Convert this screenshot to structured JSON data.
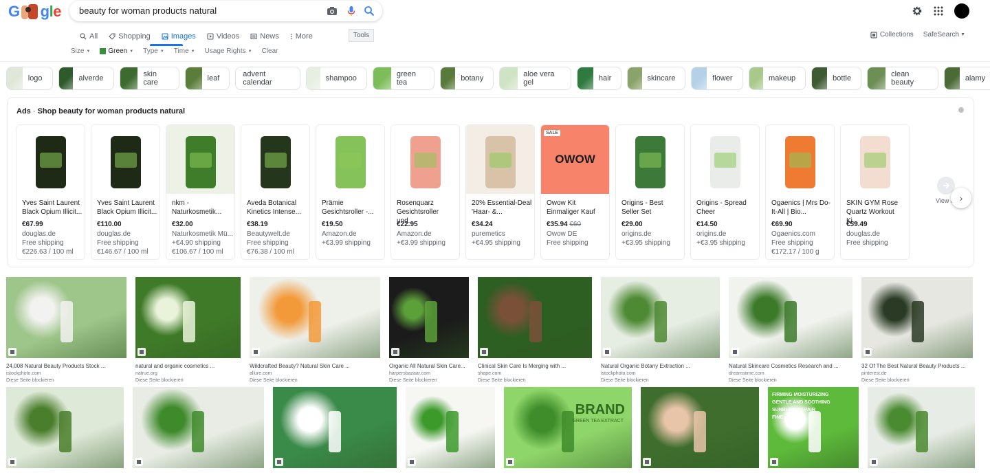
{
  "search": {
    "query": "beauty for woman products natural"
  },
  "logo": {
    "text": "Google"
  },
  "tabs": [
    {
      "label": "All",
      "icon": "search-icon"
    },
    {
      "label": "Shopping",
      "icon": "tag-icon"
    },
    {
      "label": "Images",
      "icon": "image-icon",
      "active": true
    },
    {
      "label": "Videos",
      "icon": "play-icon"
    },
    {
      "label": "News",
      "icon": "newspaper-icon"
    },
    {
      "label": "More",
      "icon": "kebab-icon"
    }
  ],
  "tools_label": "Tools",
  "collections_label": "Collections",
  "safesearch_label": "SafeSearch",
  "filters": [
    {
      "label": "Size"
    },
    {
      "label": "Green",
      "swatch": "#3a8f3a",
      "active": true
    },
    {
      "label": "Type"
    },
    {
      "label": "Time"
    },
    {
      "label": "Usage Rights"
    },
    {
      "label": "Clear"
    }
  ],
  "chips": [
    {
      "label": "logo",
      "color": "#dfe8d8"
    },
    {
      "label": "alverde",
      "color": "#2f5a2c"
    },
    {
      "label": "skin care",
      "color": "#3d6b2f"
    },
    {
      "label": "leaf",
      "color": "#5a7d3b"
    },
    {
      "label": "advent calendar",
      "color": ""
    },
    {
      "label": "shampoo",
      "color": "#e7efe3"
    },
    {
      "label": "green tea",
      "color": "#7cbd5a"
    },
    {
      "label": "botany",
      "color": "#587a3a"
    },
    {
      "label": "aloe vera gel",
      "color": "#cfe4c4"
    },
    {
      "label": "hair",
      "color": "#2f7a3e"
    },
    {
      "label": "skincare",
      "color": "#8aa36a"
    },
    {
      "label": "flower",
      "color": "#b5d1e8"
    },
    {
      "label": "makeup",
      "color": "#a9c98c"
    },
    {
      "label": "bottle",
      "color": "#3e5b34"
    },
    {
      "label": "clean beauty",
      "color": "#6d8f56"
    },
    {
      "label": "alamy",
      "color": "#4b6a36"
    }
  ],
  "ads": {
    "prefix": "Ads",
    "title": "Shop beauty for woman products natural",
    "view_all_label": "View all",
    "items": [
      {
        "title": "Yves Saint Laurent Black Opium Illicit...",
        "price": "€67.99",
        "old_price": "",
        "store": "douglas.de",
        "shipping": "Free shipping",
        "unit": "€226.63 / 100 ml",
        "bg": "#ffffff",
        "product": "#1e2a16",
        "sale": ""
      },
      {
        "title": "Yves Saint Laurent Black Opium Illicit...",
        "price": "€110.00",
        "old_price": "",
        "store": "douglas.de",
        "shipping": "Free shipping",
        "unit": "€146.67 / 100 ml",
        "bg": "#ffffff",
        "product": "#1e2a16",
        "sale": ""
      },
      {
        "title": "nkm - Naturkosmetik...",
        "price": "€32.00",
        "old_price": "",
        "store": "Naturkosmetik Mü...",
        "shipping": "+€4.90 shipping",
        "unit": "€106.67 / 100 ml",
        "bg": "#eef1e6",
        "product": "#3f7d2a",
        "sale": ""
      },
      {
        "title": "Aveda Botanical Kinetics Intense...",
        "price": "€38.19",
        "old_price": "",
        "store": "Beautywelt.de",
        "shipping": "Free shipping",
        "unit": "€76.38 / 100 ml",
        "bg": "#ffffff",
        "product": "#24371c",
        "sale": ""
      },
      {
        "title": "Prämie Gesichtsroller -...",
        "price": "€19.50",
        "old_price": "",
        "store": "Amazon.de",
        "shipping": "+€3.99 shipping",
        "unit": "",
        "bg": "#ffffff",
        "product": "#86c25a",
        "sale": ""
      },
      {
        "title": "Rosenquarz Gesichtsroller und...",
        "price": "€22.95",
        "old_price": "",
        "store": "Amazon.de",
        "shipping": "+€3.99 shipping",
        "unit": "",
        "bg": "#ffffff",
        "product": "#f0a08e",
        "sale": ""
      },
      {
        "title": "20% Essential-Deal 'Haar- &...",
        "price": "€34.24",
        "old_price": "",
        "store": "puremetics",
        "shipping": "+€4.95 shipping",
        "unit": "",
        "bg": "#f3ede6",
        "product": "#d9c3a8",
        "sale": ""
      },
      {
        "title": "Owow Kit Einmaliger Kauf",
        "price": "€35.94",
        "old_price": "€60",
        "store": "Owow DE",
        "shipping": "Free shipping",
        "unit": "",
        "bg": "#f7836b",
        "product": "#1a1a1a",
        "sale": "SALE",
        "brand": "OWOW"
      },
      {
        "title": "Origins - Best Seller Set",
        "price": "€29.00",
        "old_price": "",
        "store": "origins.de",
        "shipping": "+€3.95 shipping",
        "unit": "",
        "bg": "#ffffff",
        "product": "#3d7a3a",
        "sale": ""
      },
      {
        "title": "Origins - Spread Cheer",
        "price": "€14.50",
        "old_price": "",
        "store": "origins.de",
        "shipping": "+€3.95 shipping",
        "unit": "",
        "bg": "#ffffff",
        "product": "#e9ece8",
        "sale": ""
      },
      {
        "title": "Ogaenics | Mrs Do-It-All | Bio...",
        "price": "€69.90",
        "old_price": "",
        "store": "Ogaenics.com",
        "shipping": "Free shipping",
        "unit": "€172.17 / 100 g",
        "bg": "#ffffff",
        "product": "#ef7a32",
        "sale": ""
      },
      {
        "title": "SKIN GYM Rose Quartz Workout Ki...",
        "price": "€59.49",
        "old_price": "",
        "store": "douglas.de",
        "shipping": "Free shipping",
        "unit": "",
        "bg": "#ffffff",
        "product": "#f3dcd0",
        "sale": ""
      }
    ]
  },
  "images_row1": [
    {
      "caption": "24,008 Natural Beauty Products Stock ...",
      "source": "istockphoto.com",
      "block": "Diese Seite blockieren",
      "color": "#9ec58a",
      "accent": "#f2f2f0"
    },
    {
      "caption": "natural and organic cosmetics ...",
      "source": "natrue.org",
      "block": "Diese Seite blockieren",
      "color": "#3f7a28",
      "accent": "#e9f3d9"
    },
    {
      "caption": "Wildcrafted Beauty? Natural Skin Care ...",
      "source": "allure.com",
      "block": "Diese Seite blockieren",
      "color": "#eef0ea",
      "accent": "#f29a3a"
    },
    {
      "caption": "Organic All Natural Skin Care...",
      "source": "harpersbazaar.com",
      "block": "Diese Seite blockieren",
      "color": "#1b1b1b",
      "accent": "#5ca03a"
    },
    {
      "caption": "Clinical Skin Care Is Merging with ...",
      "source": "shape.com",
      "block": "Diese Seite blockieren",
      "color": "#2d5e22",
      "accent": "#7a5138"
    },
    {
      "caption": "Natural Organic Botany Extraction ...",
      "source": "istockphoto.com",
      "block": "Diese Seite blockieren",
      "color": "#e6ede3",
      "accent": "#4e8a33"
    },
    {
      "caption": "Natural Skincare Cosmetics Research and ...",
      "source": "dreamstime.com",
      "block": "Diese Seite blockieren",
      "color": "#f1f3ee",
      "accent": "#3c7a2a"
    },
    {
      "caption": "32 Of The Best Natural Beauty Products ...",
      "source": "pinterest.de",
      "block": "Diese Seite blockieren",
      "color": "#e6e7e1",
      "accent": "#2a3a24"
    }
  ],
  "images_row2": [
    {
      "color": "#dfe9d8",
      "accent": "#4b7e2c"
    },
    {
      "color": "#e8ece4",
      "accent": "#3f8b2c"
    },
    {
      "color": "#3a8a4a",
      "accent": "#ffffff"
    },
    {
      "color": "#f6f7f3",
      "accent": "#3b9a2a"
    },
    {
      "color": "#8fd66a",
      "accent": "#3e8c2a",
      "brand": "BRAND",
      "brand_sub": "GREEN TEA EXTRACT"
    },
    {
      "color": "#3e6d2e",
      "accent": "#e8c4a8"
    },
    {
      "color": "#5dba3a",
      "accent": "#ffffff",
      "lines": [
        "FIRMING MOISTURIZING",
        "GENTLE AND SOOTHING",
        "SUNBURN REPAIR",
        "FINE PORES"
      ]
    },
    {
      "color": "#e8ece6",
      "accent": "#4a8a30"
    }
  ]
}
